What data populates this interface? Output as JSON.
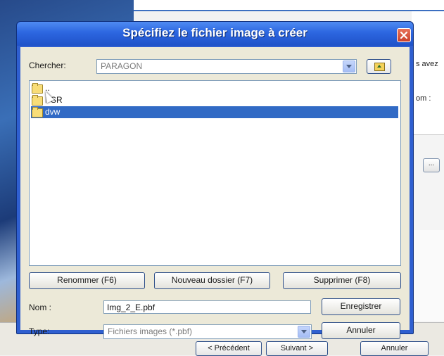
{
  "dialog": {
    "title": "Spécifiez le fichier image à créer",
    "look_in_label": "Chercher:",
    "look_in_value": "PARAGON",
    "files": [
      {
        "name": "..",
        "selected": false
      },
      {
        "name": "PSR",
        "selected": false
      },
      {
        "name": "dvw",
        "selected": true
      }
    ],
    "buttons": {
      "rename": "Renommer (F6)",
      "new_folder": "Nouveau dossier (F7)",
      "delete": "Supprimer (F8)",
      "save": "Enregistrer",
      "cancel": "Annuler"
    },
    "name_label": "Nom :",
    "name_value": "Img_2_E.pbf",
    "type_label": "Type:",
    "type_value": "Fichiers images (*.pbf)"
  },
  "background": {
    "text_1": "s avez",
    "text_2": "om :",
    "browse_label": "...",
    "wizard_buttons": {
      "previous": "< Précédent",
      "next": "Suivant >",
      "cancel": "Annuler"
    }
  },
  "colors": {
    "title_bar": "#2c66e0",
    "selection": "#316ac5",
    "close": "#c9412b"
  }
}
